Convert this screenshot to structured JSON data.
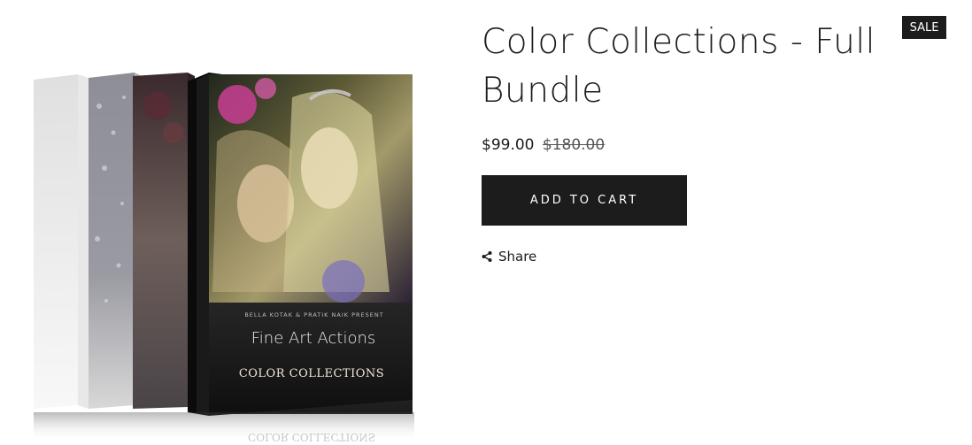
{
  "product": {
    "title_line1": "Color Collections - Full",
    "title_line2": "Bundle",
    "price": "$99.00",
    "compare_price": "$180.00",
    "add_to_cart_label": "ADD TO CART",
    "share_label": "Share",
    "sale_badge": "SALE"
  },
  "box_art": {
    "presenter_line": "BELLA KOTAK & PRATIK NAIK PRESENT",
    "product_name": "Fine Art Actions",
    "collection_name": "COLOR COLLECTIONS",
    "reflection_text": "COLOR COLLECTIONS"
  },
  "colors": {
    "ink": "#1c1c1c",
    "button_bg": "#1c1c1c",
    "badge_bg": "#1c1c1c",
    "background": "#ffffff"
  },
  "icons": {
    "share": "share-icon"
  }
}
